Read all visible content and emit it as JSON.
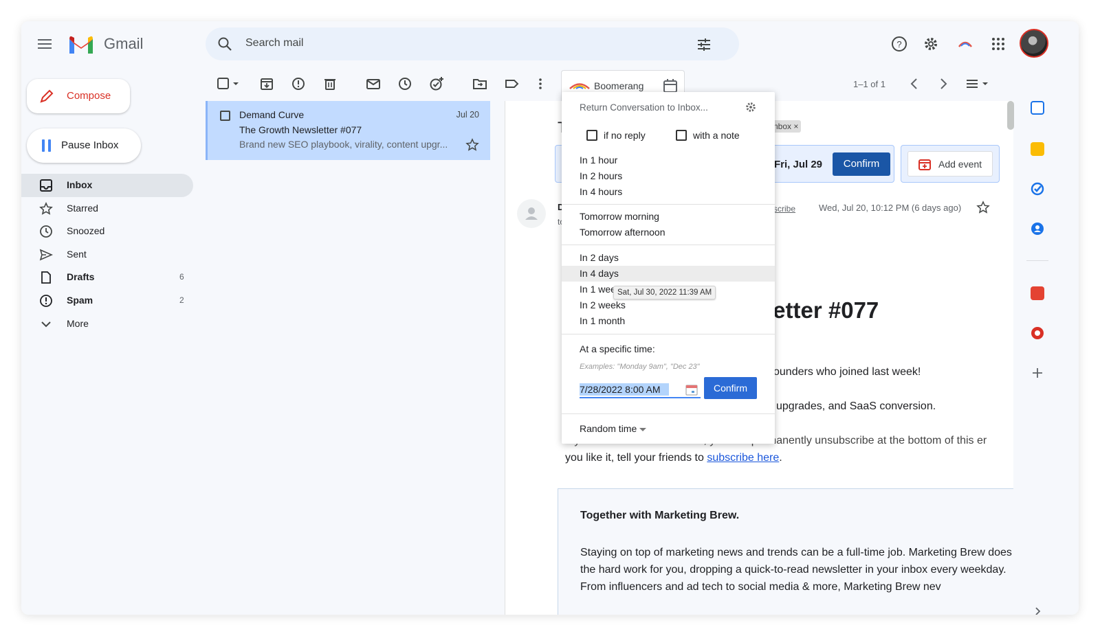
{
  "app": {
    "name": "Gmail"
  },
  "search": {
    "placeholder": "Search mail"
  },
  "sidebar": {
    "compose_label": "Compose",
    "pause_label": "Pause Inbox",
    "items": [
      {
        "label": "Inbox",
        "count": "",
        "icon": "inbox-icon"
      },
      {
        "label": "Starred",
        "count": "",
        "icon": "star-icon"
      },
      {
        "label": "Snoozed",
        "count": "",
        "icon": "clock-icon"
      },
      {
        "label": "Sent",
        "count": "",
        "icon": "send-icon"
      },
      {
        "label": "Drafts",
        "count": "6",
        "icon": "draft-icon"
      },
      {
        "label": "Spam",
        "count": "2",
        "icon": "spam-icon"
      },
      {
        "label": "More",
        "count": "",
        "icon": "chevron-down-icon"
      }
    ]
  },
  "toolbar": {
    "boomerang_label": "Boomerang",
    "paging": "1–1 of 1"
  },
  "email_list": {
    "rows": [
      {
        "from": "Demand Curve",
        "date": "Jul 20",
        "subject": "The Growth Newsletter #077",
        "snippet": "Brand new SEO playbook, virality, content upgr..."
      }
    ]
  },
  "reading": {
    "subject_start": "T",
    "inbox_chip": "nbox ×",
    "calendar_date": "Fri, Jul 29",
    "calendar_confirm": "Confirm",
    "add_event": "Add event",
    "sender_initial": "D",
    "sender_to": "to",
    "unsubscribe": "scribe",
    "message_date": "Wed, Jul 20, 10:12 PM (6 days ago)",
    "title_fragment": "letter #077",
    "p1": "ounders who joined last week!",
    "p2": "upgrades, and SaaS conversion.",
    "p3_start": "If you don't find this valuable, you can permanently unsubscribe at the bottom of this er",
    "p4_start": "you like it, tell your friends to ",
    "p4_link": "subscribe here",
    "p4_end": ".",
    "promo_heading": "Together with Marketing Brew.",
    "promo_body": "Staying on top of marketing news and trends can be a full-time job. Marketing Brew does the hard work for you, dropping a quick-to-read newsletter in your inbox every weekday. From influencers and ad tech to social media & more, Marketing Brew nev"
  },
  "boomerang_popup": {
    "title": "Return Conversation to Inbox...",
    "if_no_reply": "if no reply",
    "with_a_note": "with a note",
    "group1": [
      "In 1 hour",
      "In 2 hours",
      "In 4 hours"
    ],
    "group2": [
      "Tomorrow morning",
      "Tomorrow afternoon"
    ],
    "group3": [
      "In 2 days",
      "In 4 days",
      "In 1 wee",
      "In 2 weeks",
      "In 1 month"
    ],
    "tooltip": "Sat, Jul 30, 2022 11:39 AM",
    "specific_label": "At a specific time:",
    "examples": "Examples: \"Monday 9am\", \"Dec 23\"",
    "datetime_value": "7/28/2022 8:00 AM",
    "confirm_label": "Confirm",
    "random_label": "Random time"
  },
  "colors": {
    "accent": "#1a73e8",
    "selected_row": "#c2dbff",
    "compose_text": "#d93025"
  }
}
